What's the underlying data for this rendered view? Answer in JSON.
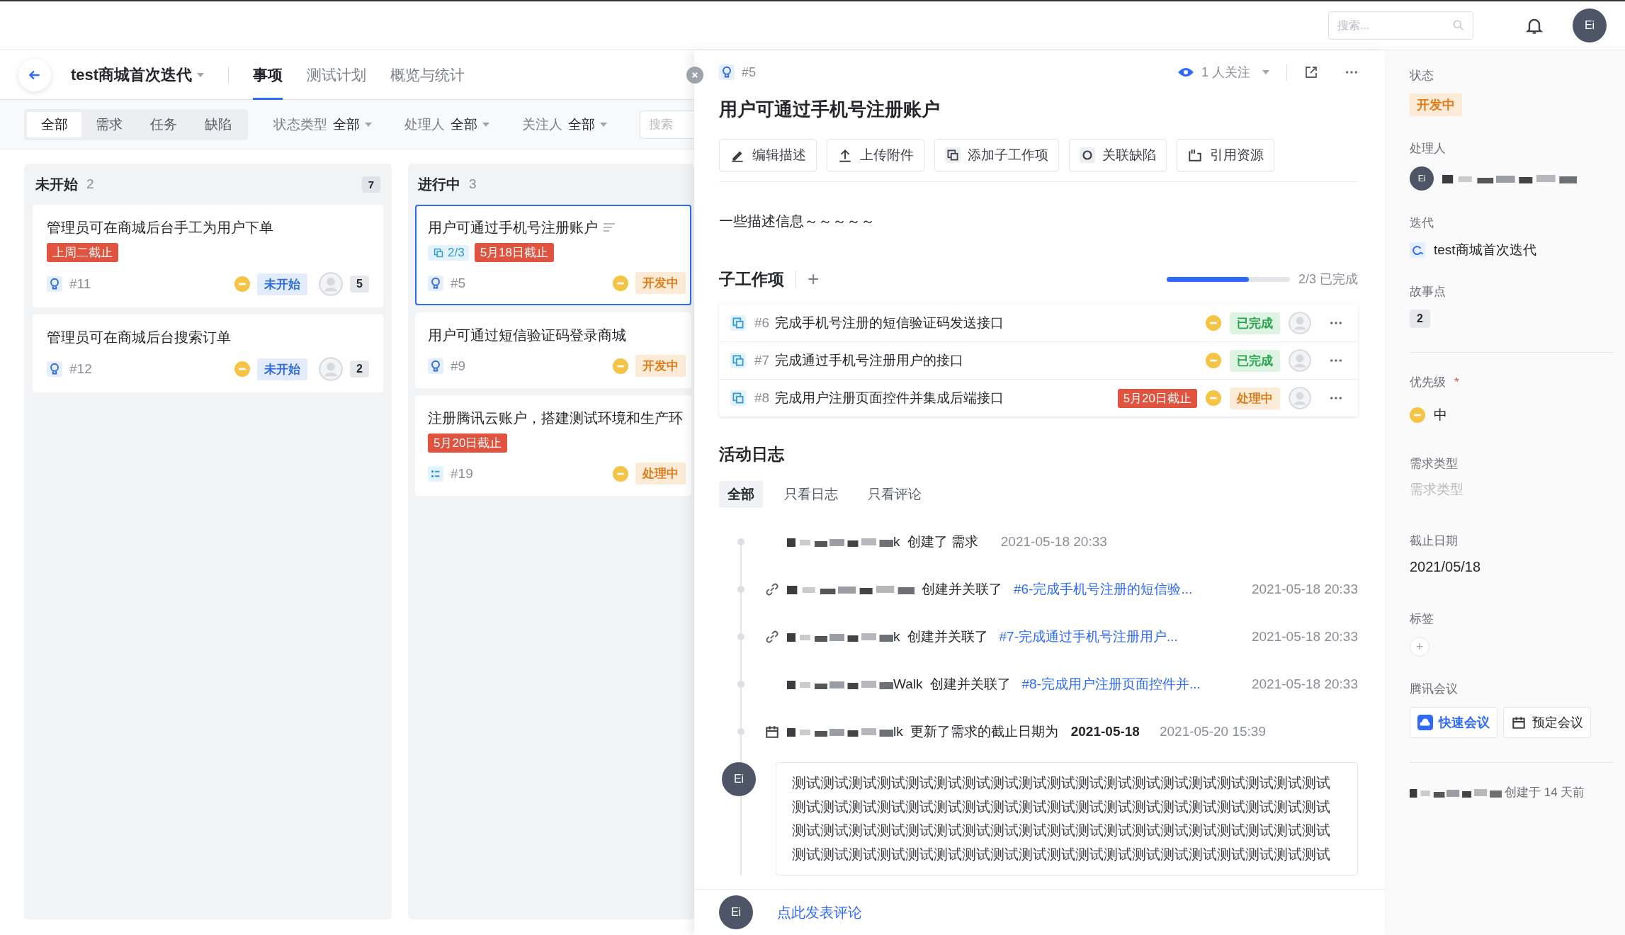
{
  "top_bar": {
    "search_placeholder": "搜索...",
    "avatar": "Ei"
  },
  "iteration": {
    "title": "test商城首次迭代",
    "tabs": [
      {
        "label": "事项",
        "selected": true
      },
      {
        "label": "测试计划",
        "selected": false
      },
      {
        "label": "概览与统计",
        "selected": false
      }
    ]
  },
  "filters": {
    "type_tabs": [
      {
        "label": "全部",
        "selected": true
      },
      {
        "label": "需求",
        "selected": false
      },
      {
        "label": "任务",
        "selected": false
      },
      {
        "label": "缺陷",
        "selected": false
      }
    ],
    "dropdowns": [
      {
        "label": "状态类型",
        "value": "全部"
      },
      {
        "label": "处理人",
        "value": "全部"
      },
      {
        "label": "关注人",
        "value": "全部"
      }
    ],
    "search_placeholder": "搜索"
  },
  "board": {
    "columns": [
      {
        "title": "未开始",
        "count": "2",
        "badge": "7",
        "cards": [
          {
            "title": "管理员可在商城后台手工为用户下单",
            "kind": "requirement",
            "deadline": "上周二截止",
            "id": "#11",
            "status": {
              "label": "未开始",
              "kind": "todo"
            },
            "comments": "5",
            "selected": false
          },
          {
            "title": "管理员可在商城后台搜索订单",
            "kind": "requirement",
            "id": "#12",
            "status": {
              "label": "未开始",
              "kind": "todo"
            },
            "comments": "2",
            "selected": false
          }
        ]
      },
      {
        "title": "进行中",
        "count": "3",
        "cards": [
          {
            "title": "用户可通过手机号注册账户",
            "kind": "requirement",
            "has_description": true,
            "progress": "2/3",
            "deadline": "5月18日截止",
            "id": "#5",
            "status": {
              "label": "开发中",
              "kind": "doing"
            },
            "selected": true
          },
          {
            "title": "用户可通过短信验证码登录商城",
            "kind": "requirement",
            "id": "#9",
            "status": {
              "label": "开发中",
              "kind": "doing"
            },
            "selected": false
          },
          {
            "title": "注册腾讯云账户，搭建测试环境和生产环",
            "kind": "task",
            "deadline": "5月20日截止",
            "id": "#19",
            "status": {
              "label": "处理中",
              "kind": "doing"
            },
            "selected": false
          }
        ]
      }
    ]
  },
  "detail": {
    "id": "#5",
    "kind": "requirement",
    "watchers": "1 人关注",
    "title": "用户可通过手机号注册账户",
    "actions": [
      {
        "label": "编辑描述",
        "kind": "edit"
      },
      {
        "label": "上传附件",
        "kind": "upload"
      },
      {
        "label": "添加子工作项",
        "kind": "subtask"
      },
      {
        "label": "关联缺陷",
        "kind": "defect"
      },
      {
        "label": "引用资源",
        "kind": "resource"
      }
    ],
    "description": "一些描述信息～～～～～",
    "subtasks": {
      "title": "子工作项",
      "add": "+",
      "level": 0.667,
      "progress_text": "2/3 已完成",
      "items": [
        {
          "id": "#6",
          "title": "完成手机号注册的短信验证码发送接口",
          "status": {
            "label": "已完成",
            "kind": "done"
          }
        },
        {
          "id": "#7",
          "title": "完成通过手机号注册用户的接口",
          "status": {
            "label": "已完成",
            "kind": "done"
          }
        },
        {
          "id": "#8",
          "title": "完成用户注册页面控件并集成后端接口",
          "deadline": "5月20日截止",
          "status": {
            "label": "处理中",
            "kind": "doing"
          }
        }
      ]
    },
    "activity": {
      "title": "活动日志",
      "tabs": [
        {
          "label": "全部",
          "selected": true
        },
        {
          "label": "只看日志",
          "selected": false
        },
        {
          "label": "只看评论",
          "selected": false
        }
      ],
      "entries": [
        {
          "kind": "plain",
          "name_tail": "k",
          "action": "创建了 需求",
          "time": "2021-05-18 20:33"
        },
        {
          "kind": "link",
          "action": "创建并关联了",
          "link": "#6-完成手机号注册的短信验...",
          "time": "2021-05-18 20:33"
        },
        {
          "kind": "link",
          "name_tail": "k",
          "action": "创建并关联了",
          "link": "#7-完成通过手机号注册用户...",
          "time": "2021-05-18 20:33"
        },
        {
          "kind": "plain",
          "name_tail": "Walk",
          "action": "创建并关联了",
          "link": "#8-完成用户注册页面控件并...",
          "time": "2021-05-18 20:33"
        },
        {
          "kind": "calendar",
          "name_tail": "lk",
          "action": "更新了需求的截止日期为",
          "value": "2021-05-18",
          "time": "2021-05-20 15:39"
        }
      ],
      "comment": {
        "avatar": "Ei",
        "text": "测试测试测试测试测试测试测试测试测试测试测试测试测试测试测试测试测试测试测试测试测试测试测试测试测试测试测试测试测试测试测试测试测试测试测试测试测试测试测试测试测试测试测试测试测试测试测试测试测试测试测试测试测试测试测试测试测试测试测试测试测试测试测试测试测试测试测试测试测试测试测试测试测试测试测试测试"
      }
    },
    "composer": {
      "avatar": "Ei",
      "prompt": "点此发表评论"
    }
  },
  "sidebar": {
    "status_label": "状态",
    "status": "开发中",
    "assignee_label": "处理人",
    "assignee_avatar": "Ei",
    "iteration_label": "迭代",
    "iteration": "test商城首次迭代",
    "points_label": "故事点",
    "points": "2",
    "priority_label": "优先级",
    "required_mark": "*",
    "priority": "中",
    "type_label": "需求类型",
    "type_placeholder": "需求类型",
    "deadline_label": "截止日期",
    "deadline": "2021/05/18",
    "tags_label": "标签",
    "tags_add": "+",
    "meeting_label": "腾讯会议",
    "meeting_buttons": [
      {
        "label": "快速会议",
        "kind": "quick"
      },
      {
        "label": "预定会议",
        "kind": "schedule"
      }
    ],
    "created": "创建于 14 天前"
  }
}
